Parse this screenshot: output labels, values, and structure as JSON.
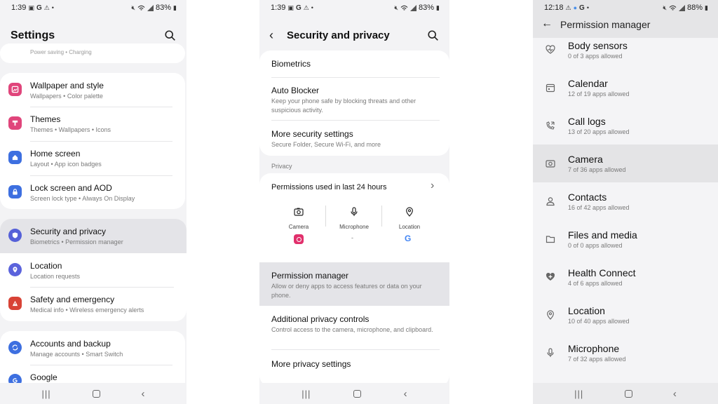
{
  "phone1": {
    "status": {
      "time": "1:39",
      "battery": "83%"
    },
    "title": "Settings",
    "peek_text": "Power saving  •  Charging",
    "items": [
      {
        "title": "Wallpaper and style",
        "sub": "Wallpapers  •  Color palette",
        "icon": "wallpaper-icon",
        "color": "#e0457b"
      },
      {
        "title": "Themes",
        "sub": "Themes  •  Wallpapers  •  Icons",
        "icon": "themes-icon",
        "color": "#e0457b"
      },
      {
        "title": "Home screen",
        "sub": "Layout  •  App icon badges",
        "icon": "home-icon",
        "color": "#3d6fe0"
      },
      {
        "title": "Lock screen and AOD",
        "sub": "Screen lock type  •  Always On Display",
        "icon": "lock-icon",
        "color": "#3d6fe0"
      },
      {
        "title": "Security and privacy",
        "sub": "Biometrics  •  Permission manager",
        "icon": "shield-icon",
        "color": "#5560d8"
      },
      {
        "title": "Location",
        "sub": "Location requests",
        "icon": "location-icon",
        "color": "#5b63dc"
      },
      {
        "title": "Safety and emergency",
        "sub": "Medical info  •  Wireless emergency alerts",
        "icon": "emergency-icon",
        "color": "#d84336"
      },
      {
        "title": "Accounts and backup",
        "sub": "Manage accounts  •  Smart Switch",
        "icon": "sync-icon",
        "color": "#3d6fe0"
      },
      {
        "title": "Google",
        "sub": "",
        "icon": "google-icon",
        "color": "#3d6fe0"
      }
    ]
  },
  "phone2": {
    "status": {
      "time": "1:39",
      "battery": "83%"
    },
    "title": "Security and privacy",
    "biometrics": "Biometrics",
    "auto_blocker": {
      "title": "Auto Blocker",
      "sub": "Keep your phone safe by blocking threats and other suspicious activity."
    },
    "more_security": {
      "title": "More security settings",
      "sub": "Secure Folder, Secure Wi-Fi, and more"
    },
    "privacy_header": "Privacy",
    "perm_used": "Permissions used in last 24 hours",
    "perm_types": [
      "Camera",
      "Microphone",
      "Location"
    ],
    "mic_none": "-",
    "perm_manager": {
      "title": "Permission manager",
      "sub": "Allow or deny apps to access features or data on your phone."
    },
    "additional": {
      "title": "Additional privacy controls",
      "sub": "Control access to the camera, microphone, and clipboard."
    },
    "more_privacy": "More privacy settings"
  },
  "phone3": {
    "status": {
      "time": "12:18",
      "battery": "88%"
    },
    "title": "Permission manager",
    "items": [
      {
        "title": "Body sensors",
        "sub": "0 of 3 apps allowed",
        "icon": "heart-icon"
      },
      {
        "title": "Calendar",
        "sub": "12 of 19 apps allowed",
        "icon": "calendar-icon"
      },
      {
        "title": "Call logs",
        "sub": "13 of 20 apps allowed",
        "icon": "call-log-icon"
      },
      {
        "title": "Camera",
        "sub": "7 of 36 apps allowed",
        "icon": "camera-icon"
      },
      {
        "title": "Contacts",
        "sub": "16 of 42 apps allowed",
        "icon": "contacts-icon"
      },
      {
        "title": "Files and media",
        "sub": "0 of 0 apps allowed",
        "icon": "folder-icon"
      },
      {
        "title": "Health Connect",
        "sub": "4 of 6 apps allowed",
        "icon": "health-icon"
      },
      {
        "title": "Location",
        "sub": "10 of 40 apps allowed",
        "icon": "location-icon"
      },
      {
        "title": "Microphone",
        "sub": "7 of 32 apps allowed",
        "icon": "microphone-icon"
      }
    ]
  }
}
